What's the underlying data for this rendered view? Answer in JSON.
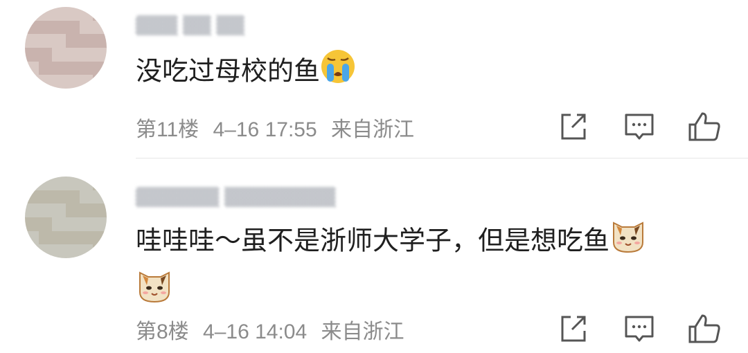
{
  "comments": [
    {
      "username": "▒▒▒ ▒▒ ▒▒",
      "text": "没吃过母校的鱼",
      "emojis": [
        "crying-face-icon"
      ],
      "floor": "第11楼",
      "time": "4–16 17:55",
      "location": "来自浙江"
    },
    {
      "username": "▒▒▒▒▒▒ ▒▒▒▒▒▒▒▒",
      "text": "哇哇哇～虽不是浙师大学子，但是想吃鱼",
      "emojis": [
        "cat-face-icon",
        "cat-face-icon"
      ],
      "floor": "第8楼",
      "time": "4–16 14:04",
      "location": "来自浙江"
    }
  ],
  "actions": [
    "share-icon",
    "comment-icon",
    "like-icon"
  ]
}
